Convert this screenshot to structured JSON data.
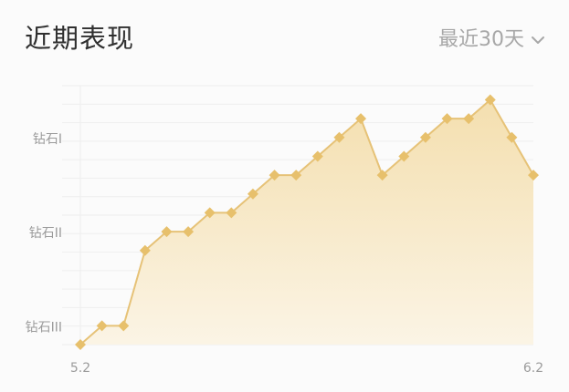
{
  "header": {
    "title": "近期表现",
    "range_label": "最近30天",
    "dropdown_icon": "chevron-down-icon"
  },
  "colors": {
    "line": "#e6c277",
    "marker": "#e7c06c",
    "fill_top": "#f4dfaf",
    "fill_bottom": "#fbf4e5",
    "grid": "#eeeeee",
    "text": "#9b9b9b"
  },
  "chart_data": {
    "type": "area",
    "title": "",
    "xlabel": "",
    "ylabel": "",
    "x_labels": [
      "5.2",
      "6.2"
    ],
    "y_tick_labels": [
      "钻石III",
      "钻石II",
      "钻石I"
    ],
    "y_tick_values": [
      1,
      2,
      3
    ],
    "ylim": [
      0.8,
      3.55
    ],
    "xlim": [
      1,
      22
    ],
    "grid": true,
    "legend": "none",
    "series": [
      {
        "values": [
          0.8,
          1.0,
          1.0,
          1.8,
          2.0,
          2.0,
          2.2,
          2.2,
          2.4,
          2.6,
          2.6,
          2.8,
          3.0,
          3.2,
          2.6,
          2.8,
          3.0,
          3.2,
          3.2,
          3.4,
          3.0,
          2.6
        ]
      }
    ]
  }
}
